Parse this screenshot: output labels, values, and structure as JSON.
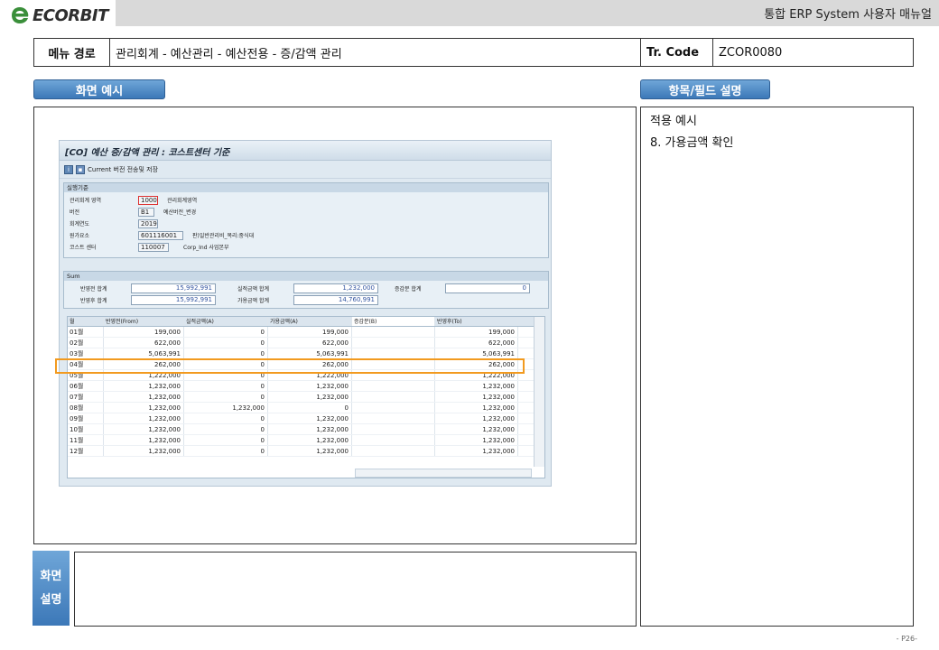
{
  "header": {
    "logo_text": "ECORBIT",
    "manual_title": "통합 ERP System 사용자 매뉴얼"
  },
  "path_row": {
    "menu_label": "메뉴 경로",
    "menu_path": "관리회계 - 예산관리 - 예산전용 - 증/감액 관리",
    "tr_label": "Tr. Code",
    "tr_code": "ZCOR0080"
  },
  "sections": {
    "screen_example": "화면 예시",
    "field_description": "항목/필드 설명",
    "screen_desc_line1": "화면",
    "screen_desc_line2": "설명"
  },
  "field_box": {
    "line1": "적용 예시",
    "line2": "8. 가용금액 확인"
  },
  "sap": {
    "title": "[CO] 예산 증/감액 관리 : 코스트센터 기준",
    "toolbar_text": "Current 버전 전송및 저장",
    "cond_title": "실행기준",
    "fields": [
      {
        "label": "관리회계 영역",
        "value": "1000",
        "text": "관리회계영역"
      },
      {
        "label": "버전",
        "value": "B1",
        "text": "예산버전_변경"
      },
      {
        "label": "회계연도",
        "value": "2019",
        "text": ""
      },
      {
        "label": "원가요소",
        "value": "601116001",
        "text": "판)일반관리비_복리:중식대"
      },
      {
        "label": "코스트 센터",
        "value": "110007",
        "text": "Corp_Ind 사업본부"
      }
    ],
    "sum_title": "Sum",
    "sum": {
      "before_label": "반영전 합계",
      "before_value": "15,992,991",
      "actual_label": "실적금액 합계",
      "actual_value": "1,232,000",
      "change_label": "증감분 합계",
      "change_value": "0",
      "after_label": "반영후 합계",
      "after_value": "15,992,991",
      "avail_label": "가용금액 합계",
      "avail_value": "14,760,991"
    },
    "grid": {
      "headers": [
        "월",
        "반영전(From)",
        "실적금액(A)",
        "가용금액(A)",
        "증감분(B)",
        "반영후(To)"
      ],
      "rows": [
        [
          "01월",
          "199,000",
          "0",
          "199,000",
          "",
          "199,000"
        ],
        [
          "02월",
          "622,000",
          "0",
          "622,000",
          "",
          "622,000"
        ],
        [
          "03월",
          "5,063,991",
          "0",
          "5,063,991",
          "",
          "5,063,991"
        ],
        [
          "04월",
          "262,000",
          "0",
          "262,000",
          "",
          "262,000"
        ],
        [
          "05월",
          "1,222,000",
          "0",
          "1,222,000",
          "",
          "1,222,000"
        ],
        [
          "06월",
          "1,232,000",
          "0",
          "1,232,000",
          "",
          "1,232,000"
        ],
        [
          "07월",
          "1,232,000",
          "0",
          "1,232,000",
          "",
          "1,232,000"
        ],
        [
          "08월",
          "1,232,000",
          "1,232,000",
          "0",
          "",
          "1,232,000"
        ],
        [
          "09월",
          "1,232,000",
          "0",
          "1,232,000",
          "",
          "1,232,000"
        ],
        [
          "10월",
          "1,232,000",
          "0",
          "1,232,000",
          "",
          "1,232,000"
        ],
        [
          "11월",
          "1,232,000",
          "0",
          "1,232,000",
          "",
          "1,232,000"
        ],
        [
          "12월",
          "1,232,000",
          "0",
          "1,232,000",
          "",
          "1,232,000"
        ]
      ]
    }
  },
  "footer": {
    "page": "- P26-"
  },
  "colors": {
    "tab_blue": "#3c78b8",
    "highlight": "#f29a1f",
    "logo_green": "#3a8f3a"
  }
}
